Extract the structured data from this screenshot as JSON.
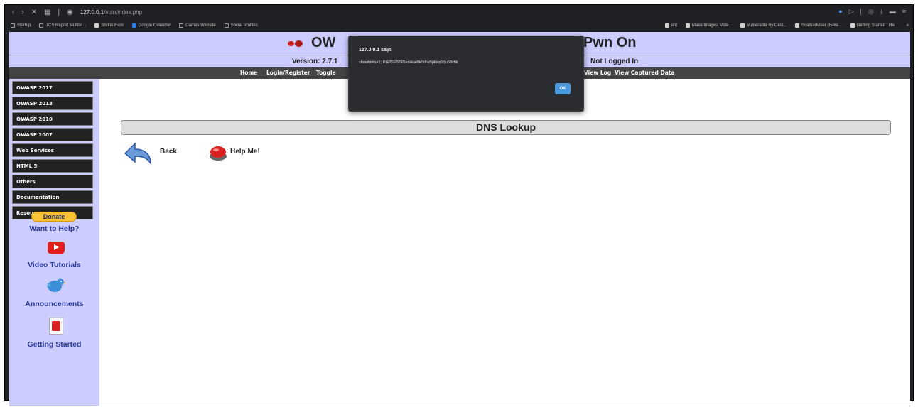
{
  "browser": {
    "address_bar": {
      "host": "127.0.0.1",
      "path": "/vuln/index.php"
    },
    "bookmarks": [
      {
        "label": "Startup",
        "icon": "folder-icon"
      },
      {
        "label": "TCS Report Multilid...",
        "icon": "folder-icon"
      },
      {
        "label": "Shrink Earn",
        "icon": "page-icon"
      },
      {
        "label": "Google Calendar",
        "icon": "calendar-icon"
      },
      {
        "label": "Games Website",
        "icon": "folder-icon"
      },
      {
        "label": "Social Profiles",
        "icon": "folder-icon"
      }
    ],
    "bookmarks_right": [
      {
        "label": "ent",
        "icon": "page-icon"
      },
      {
        "label": "Make Images, Vide...",
        "icon": "page-icon"
      },
      {
        "label": "Vulnerable By Desi...",
        "icon": "page-icon"
      },
      {
        "label": "Scamadviser (Fake...",
        "icon": "page-icon"
      },
      {
        "label": "Getting Started | Ha...",
        "icon": "page-icon"
      }
    ]
  },
  "banner": {
    "title_left": "OW",
    "title_right": "Pwn On",
    "version": "Version: 2.7.1",
    "login_status": "Not Logged In"
  },
  "menubar": {
    "home": "Home",
    "login_register": "Login/Register",
    "toggle": "Toggle",
    "view_log": "View Log",
    "view_captured": "View Captured Data"
  },
  "sidebar": {
    "items": [
      "OWASP 2017",
      "OWASP 2013",
      "OWASP 2010",
      "OWASP 2007",
      "Web Services",
      "HTML 5",
      "Others",
      "Documentation",
      "Resources"
    ],
    "donate": "Donate",
    "want_help": "Want to Help?",
    "video_tutorials": "Video Tutorials",
    "announcements": "Announcements",
    "getting_started": "Getting Started"
  },
  "content": {
    "header": "DNS Lookup",
    "back": "Back",
    "help": "Help Me!"
  },
  "dialog": {
    "title": "127.0.0.1 says",
    "message": "showhints=1; PHPSESSID=ol4ae8k0dha5j4tsq0dju68cbk",
    "ok": "OK"
  },
  "colors": {
    "banner": "#ccccff",
    "menubar": "#444444",
    "ok_button": "#4a9ae0"
  }
}
